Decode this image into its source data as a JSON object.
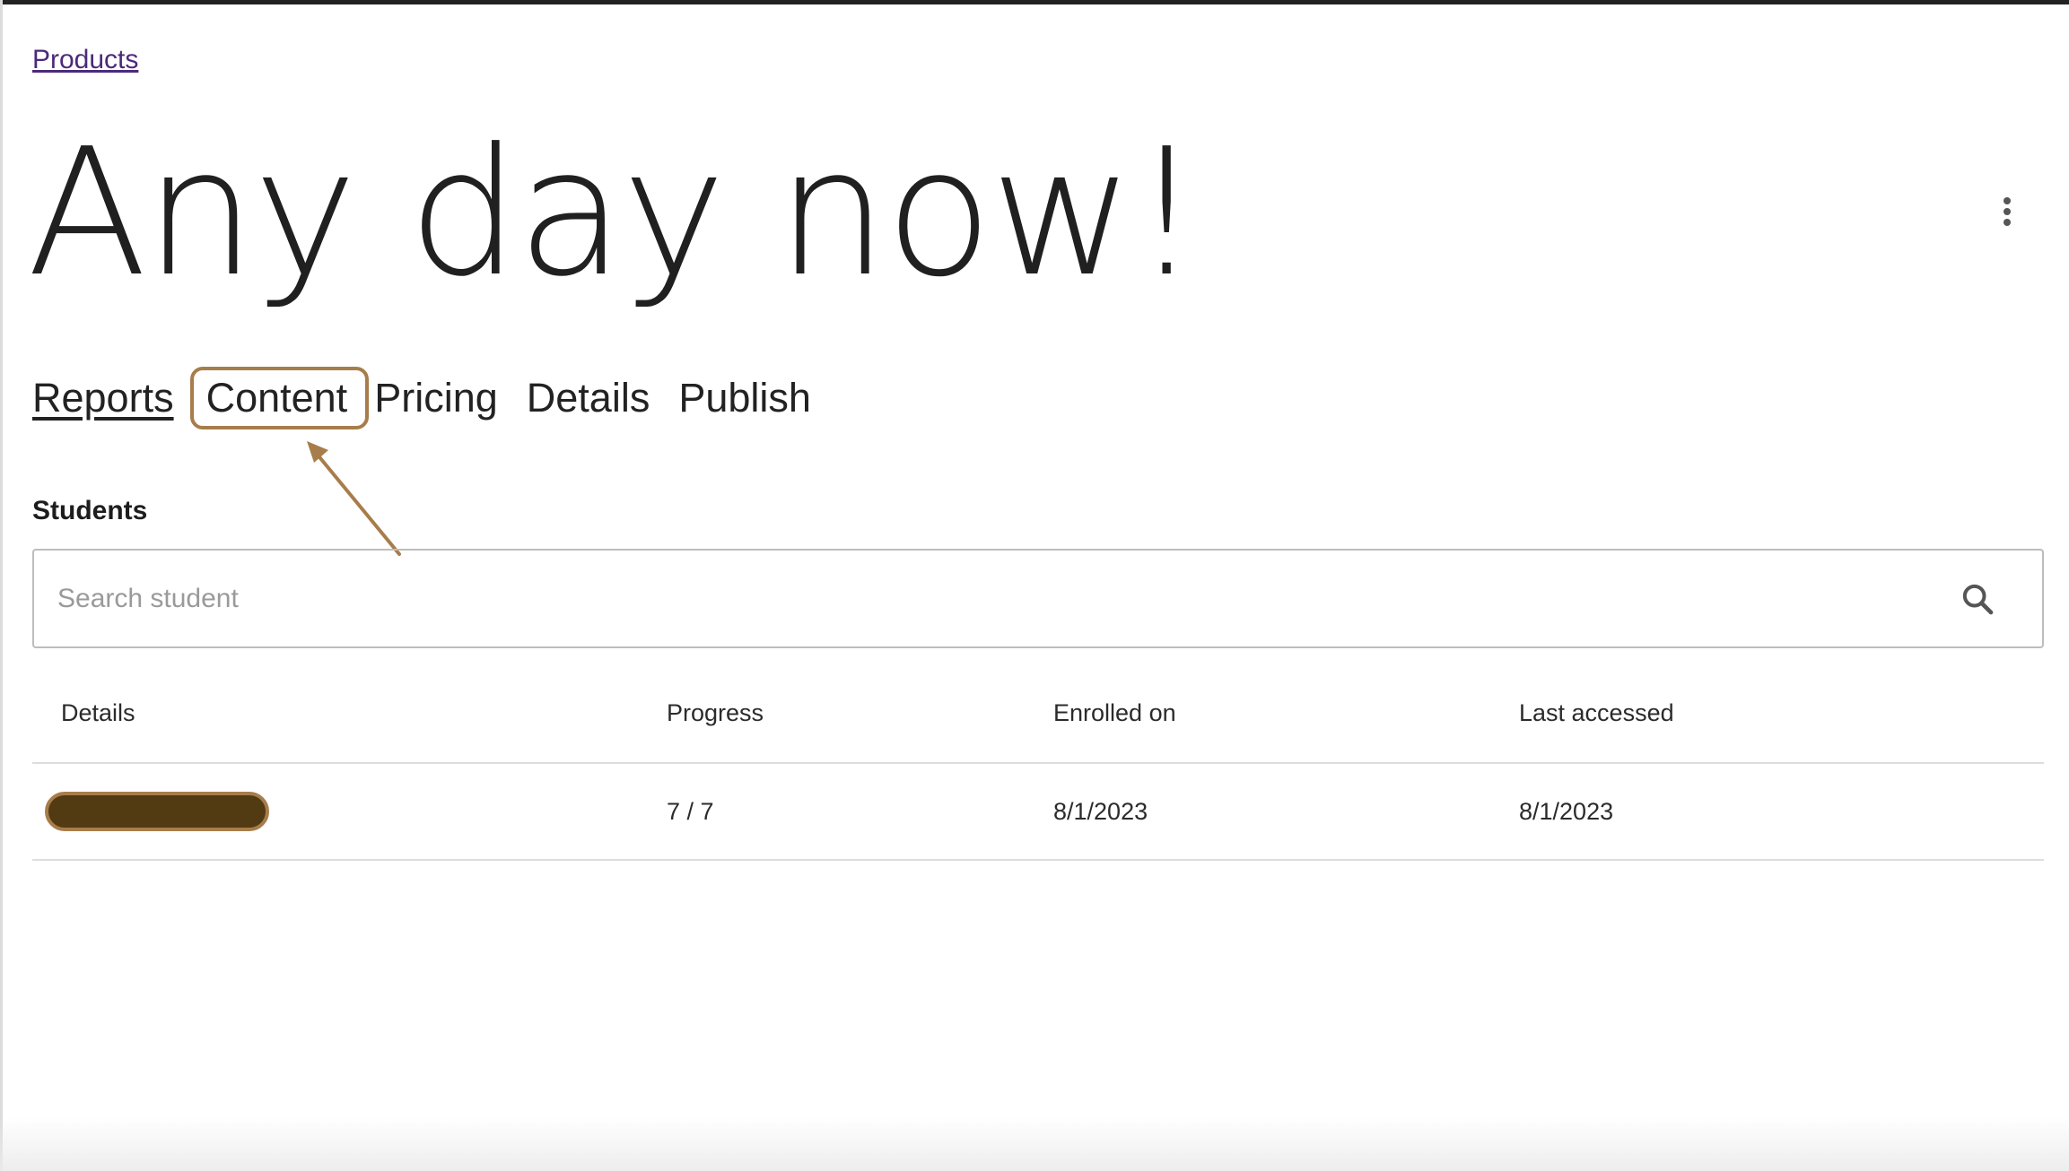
{
  "breadcrumb": {
    "label": "Products"
  },
  "page": {
    "title": "Any day now!"
  },
  "tabs": [
    {
      "label": "Reports"
    },
    {
      "label": "Content"
    },
    {
      "label": "Pricing"
    },
    {
      "label": "Details"
    },
    {
      "label": "Publish"
    }
  ],
  "students": {
    "section_title": "Students",
    "search": {
      "placeholder": "Search student",
      "value": ""
    },
    "columns": [
      "Details",
      "Progress",
      "Enrolled on",
      "Last accessed"
    ],
    "rows": [
      {
        "details": "",
        "progress": "7 / 7",
        "enrolled_on": "8/1/2023",
        "last_accessed": "8/1/2023"
      }
    ]
  },
  "colors": {
    "highlight": "#a77d4b",
    "redaction": "#523a12",
    "link": "#4b2a7a"
  },
  "icons": {
    "menu": "more-vertical-icon",
    "search": "search-icon",
    "annotation": "arrow-icon"
  }
}
